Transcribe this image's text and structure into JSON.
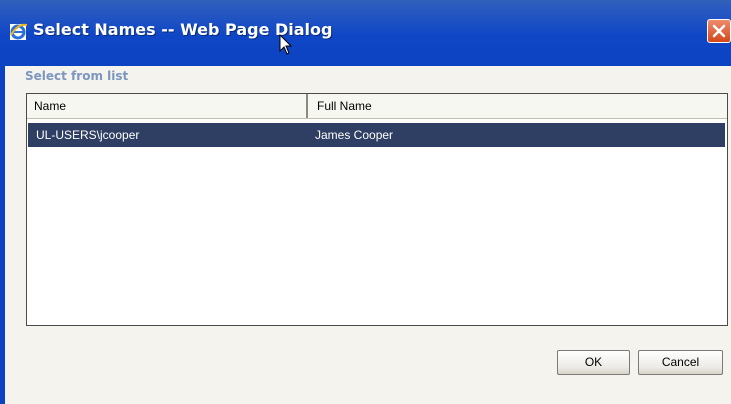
{
  "titlebar": {
    "title": "Select Names -- Web Page Dialog",
    "icon": "ie-icon",
    "close_icon": "close-icon"
  },
  "section": {
    "label": "Select from list"
  },
  "list": {
    "columns": [
      "Name",
      "Full Name"
    ],
    "rows": [
      {
        "name": "UL-USERS\\jcooper",
        "full_name": "James Cooper",
        "selected": true
      }
    ]
  },
  "buttons": {
    "ok": "OK",
    "cancel": "Cancel"
  },
  "colors": {
    "titlebar": "#0b43c2",
    "selection": "#2e3f63",
    "section_label": "#7c96bf",
    "close_button": "#d3471b"
  }
}
